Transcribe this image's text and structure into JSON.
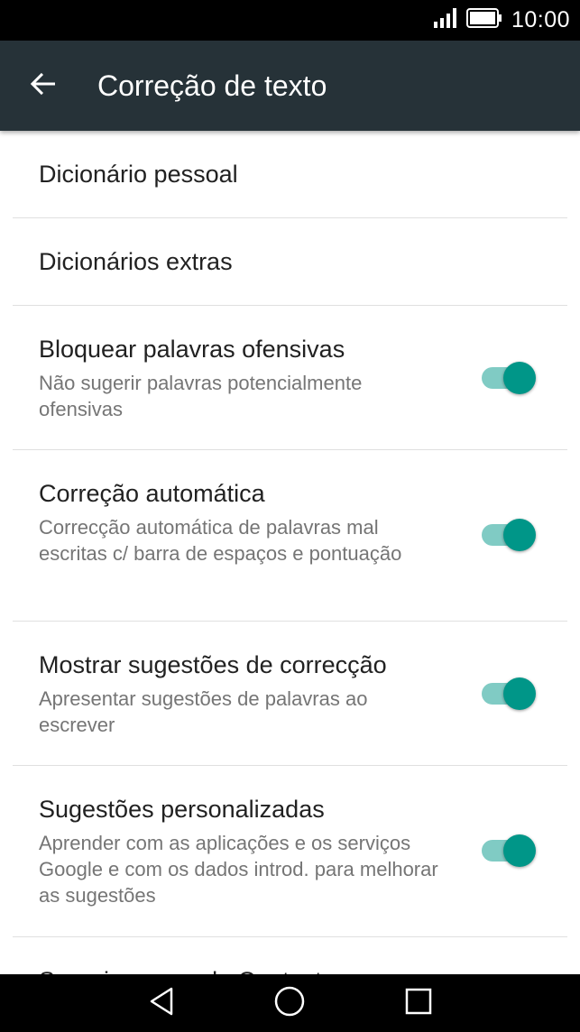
{
  "status_bar": {
    "time": "10:00",
    "signal_icon": "signal-icon",
    "battery_icon": "battery-icon"
  },
  "app_bar": {
    "back_icon": "arrow-back-icon",
    "title": "Correção de texto"
  },
  "settings": [
    {
      "title": "Dicionário pessoal"
    },
    {
      "title": "Dicionários extras"
    },
    {
      "title": "Bloquear palavras ofensivas",
      "summary": "Não sugerir palavras potencialmente ofensivas",
      "enabled": true
    },
    {
      "title": "Correção automática",
      "summary": "Correcção automática de palavras mal escritas c/ barra de espaços e pontuação",
      "enabled": true
    },
    {
      "title": "Mostrar sugestões de correcção",
      "summary": "Apresentar sugestões de palavras ao escrever",
      "enabled": true
    },
    {
      "title": "Sugestões personalizadas",
      "summary": "Aprender com as aplicações e os serviços Google e com os dados introd. para melhorar as sugestões",
      "enabled": true
    },
    {
      "title": "Sugerir nomes de Contacto"
    }
  ],
  "nav_bar": {
    "back_icon": "nav-back-icon",
    "home_icon": "nav-home-icon",
    "recents_icon": "nav-recents-icon"
  },
  "colors": {
    "app_bar": "#263238",
    "switch_thumb": "#009688",
    "switch_track": "#80cbc4"
  }
}
